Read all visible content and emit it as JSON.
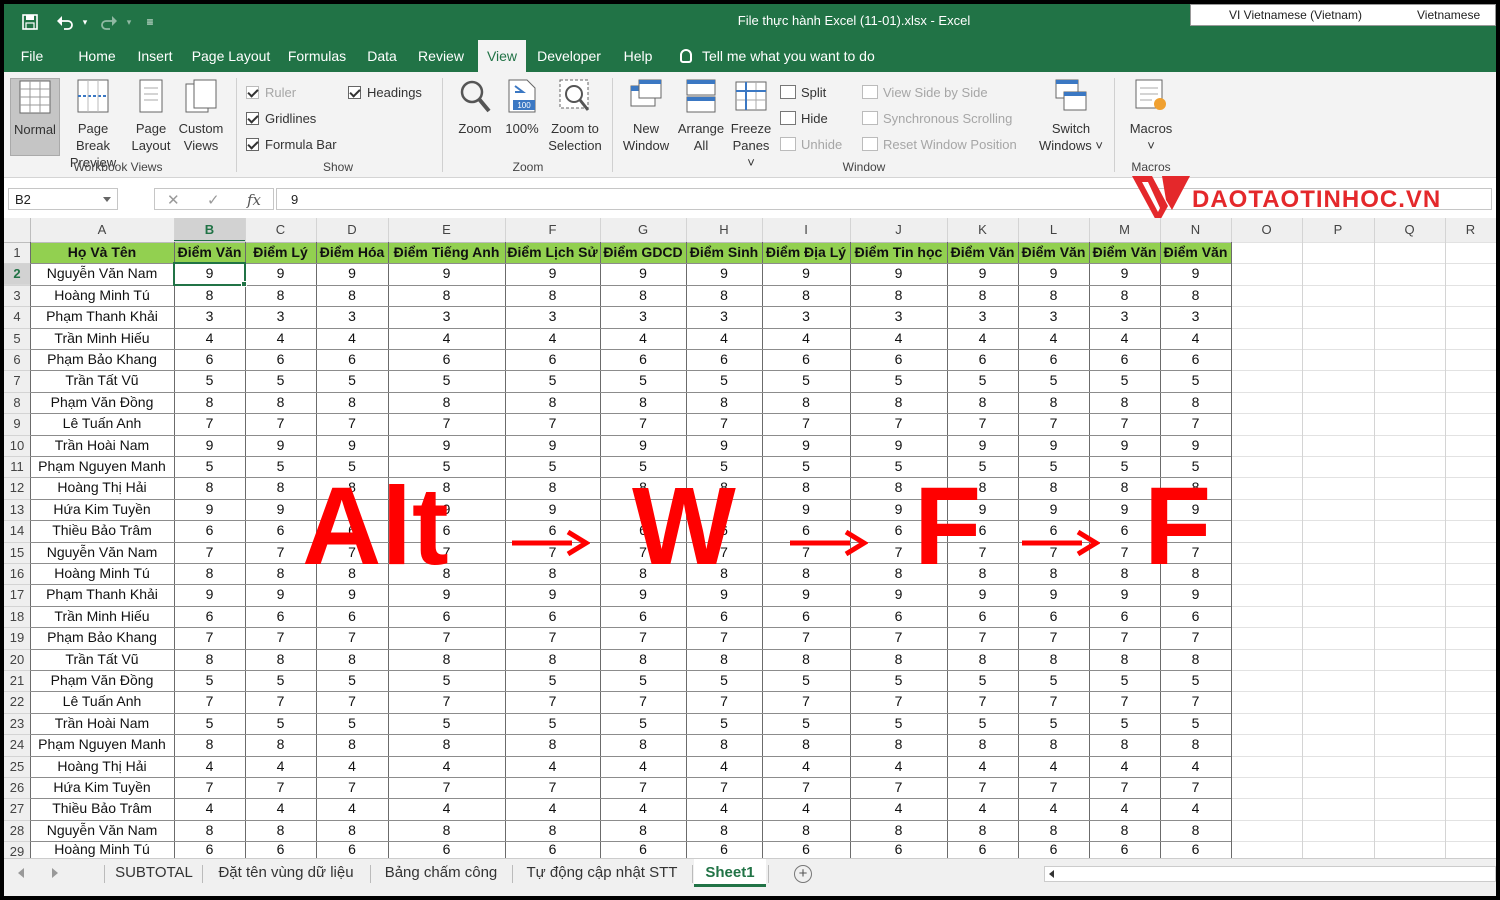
{
  "titlebar": {
    "title": "File thực hành Excel (11-01).xlsx  -  Excel",
    "language_primary": "VI  Vietnamese (Vietnam)",
    "language_secondary": "Vietnamese"
  },
  "menu": {
    "items": [
      "File",
      "Home",
      "Insert",
      "Page Layout",
      "Formulas",
      "Data",
      "Review",
      "View",
      "Developer",
      "Help"
    ],
    "active": "View",
    "tell_me": "Tell me what you want to do"
  },
  "ribbon": {
    "workbook_views": {
      "label": "Workbook Views",
      "buttons": [
        {
          "line1": "Normal",
          "line2": ""
        },
        {
          "line1": "Page Break",
          "line2": "Preview"
        },
        {
          "line1": "Page",
          "line2": "Layout"
        },
        {
          "line1": "Custom",
          "line2": "Views"
        }
      ]
    },
    "show": {
      "label": "Show",
      "ruler": "Ruler",
      "gridlines": "Gridlines",
      "formula_bar": "Formula Bar",
      "headings": "Headings"
    },
    "zoom": {
      "label": "Zoom",
      "zoom": "Zoom",
      "hundred": "100%",
      "hundred_icon_text": "100",
      "zoom_sel_1": "Zoom to",
      "zoom_sel_2": "Selection"
    },
    "window": {
      "label": "Window",
      "new_1": "New",
      "new_2": "Window",
      "arrange_1": "Arrange",
      "arrange_2": "All",
      "freeze_1": "Freeze",
      "freeze_2": "Panes ˅",
      "split": "Split",
      "hide": "Hide",
      "unhide": "Unhide",
      "side_by_side": "View Side by Side",
      "sync_scroll": "Synchronous Scrolling",
      "reset_pos": "Reset Window Position",
      "switch_1": "Switch",
      "switch_2": "Windows ˅"
    },
    "macros": {
      "label": "Macros",
      "btn": "Macros",
      "arrow": "˅"
    }
  },
  "formula_bar": {
    "name_box": "B2",
    "cancel": "✕",
    "enter": "✓",
    "fx": "fx",
    "value": "9"
  },
  "logo": {
    "text": "DAOTAOTINHOC.VN"
  },
  "sheet": {
    "columns": [
      "A",
      "B",
      "C",
      "D",
      "E",
      "F",
      "G",
      "H",
      "I",
      "J",
      "K",
      "L",
      "M",
      "N",
      "O",
      "P",
      "Q",
      "R"
    ],
    "headers": [
      "Họ Và Tên",
      "Điểm Văn",
      "Điểm Lý",
      "Điểm Hóa",
      "Điểm Tiếng Anh",
      "Điểm Lịch Sử",
      "Điểm GDCD",
      "Điểm Sinh",
      "Điểm Địa Lý",
      "Điểm Tin học",
      "Điểm Văn",
      "Điểm Văn",
      "Điểm Văn",
      "Điểm Văn"
    ],
    "row_numbers": [
      "1",
      "2",
      "3",
      "4",
      "5",
      "6",
      "7",
      "8",
      "9",
      "10",
      "11",
      "12",
      "13",
      "14",
      "15",
      "16",
      "17",
      "18",
      "19",
      "20",
      "21",
      "22",
      "23",
      "24",
      "25",
      "26",
      "27",
      "28",
      "29"
    ],
    "names": [
      "Nguyễn Văn Nam",
      "Hoàng Minh Tú",
      "Phạm Thanh Khải",
      "Trần Minh Hiếu",
      "Phạm Bảo Khang",
      "Trần Tất Vũ",
      "Phạm Văn Đồng",
      "Lê Tuấn Anh",
      "Trần Hoài Nam",
      "Phạm Nguyen Manh",
      "Hoàng Thị Hải",
      "Hứa Kim Tuyền",
      "Thiều Bảo Trâm",
      "Nguyễn Văn Nam",
      "Hoàng Minh Tú",
      "Phạm Thanh Khải",
      "Trần Minh Hiếu",
      "Phạm Bảo Khang",
      "Trần Tất Vũ",
      "Phạm Văn Đồng",
      "Lê Tuấn Anh",
      "Trần Hoài Nam",
      "Phạm Nguyen Manh",
      "Hoàng Thị Hải",
      "Hứa Kim Tuyền",
      "Thiều Bảo Trâm",
      "Nguyễn Văn Nam",
      "Hoàng Minh Tú"
    ],
    "scores": [
      "9",
      "8",
      "3",
      "4",
      "6",
      "5",
      "8",
      "7",
      "9",
      "5",
      "8",
      "9",
      "6",
      "7",
      "8",
      "9",
      "6",
      "7",
      "8",
      "5",
      "7",
      "5",
      "8",
      "4",
      "7",
      "4",
      "8",
      "6"
    ],
    "selected_cell": "B2",
    "header_fill": "#92d050",
    "accent": "#217346"
  },
  "overlay": {
    "keys": [
      "Alt",
      "W",
      "F",
      "F"
    ],
    "color": "#ff0000"
  },
  "tabs": {
    "items": [
      "SUBTOTAL",
      "Đặt tên vùng dữ liệu",
      "Bảng chấm công",
      "Tự động cập nhật STT",
      "Sheet1"
    ],
    "active": "Sheet1",
    "add": "+"
  }
}
